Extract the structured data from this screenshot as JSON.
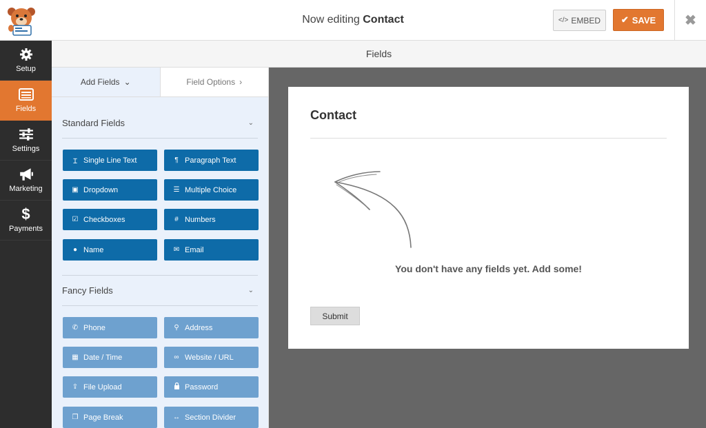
{
  "header": {
    "title_prefix": "Now editing",
    "title_name": "Contact",
    "embed_label": "EMBED",
    "save_label": "SAVE",
    "close_glyph": "✖"
  },
  "nav": {
    "items": [
      {
        "label": "Setup",
        "icon": "gear-icon"
      },
      {
        "label": "Fields",
        "icon": "fields-list-icon",
        "active": true
      },
      {
        "label": "Settings",
        "icon": "sliders-icon"
      },
      {
        "label": "Marketing",
        "icon": "megaphone-icon"
      },
      {
        "label": "Payments",
        "icon": "dollar-icon"
      }
    ]
  },
  "section_title": "Fields",
  "panel": {
    "tabs": [
      {
        "label": "Add Fields",
        "chevron": "⌄"
      },
      {
        "label": "Field Options",
        "chevron": "›"
      }
    ],
    "standard": {
      "title": "Standard Fields",
      "fields": [
        {
          "label": "Single Line Text",
          "icon": "text-cursor-icon",
          "glyph": "Ɪ"
        },
        {
          "label": "Paragraph Text",
          "icon": "pilcrow-icon",
          "glyph": "¶"
        },
        {
          "label": "Dropdown",
          "icon": "dropdown-icon",
          "glyph": "▣"
        },
        {
          "label": "Multiple Choice",
          "icon": "list-icon",
          "glyph": "☰"
        },
        {
          "label": "Checkboxes",
          "icon": "checkbox-icon",
          "glyph": "☑"
        },
        {
          "label": "Numbers",
          "icon": "hash-icon",
          "glyph": "#"
        },
        {
          "label": "Name",
          "icon": "user-icon",
          "glyph": "●"
        },
        {
          "label": "Email",
          "icon": "envelope-icon",
          "glyph": "✉"
        }
      ]
    },
    "fancy": {
      "title": "Fancy Fields",
      "fields": [
        {
          "label": "Phone",
          "icon": "phone-icon",
          "glyph": "✆"
        },
        {
          "label": "Address",
          "icon": "map-pin-icon",
          "glyph": "⚲"
        },
        {
          "label": "Date / Time",
          "icon": "calendar-icon",
          "glyph": "▦"
        },
        {
          "label": "Website / URL",
          "icon": "link-icon",
          "glyph": "∞"
        },
        {
          "label": "File Upload",
          "icon": "upload-icon",
          "glyph": "⇪"
        },
        {
          "label": "Password",
          "icon": "lock-icon",
          "glyph": "🔒"
        },
        {
          "label": "Page Break",
          "icon": "copy-icon",
          "glyph": "❐"
        },
        {
          "label": "Section Divider",
          "icon": "arrows-h-icon",
          "glyph": "↔"
        }
      ]
    }
  },
  "preview": {
    "form_title": "Contact",
    "empty_message": "You don't have any fields yet. Add some!",
    "submit_label": "Submit"
  },
  "colors": {
    "accent": "#e27730",
    "standard_button": "#0e6ba8",
    "fancy_button": "#6ea1cf",
    "nav_bg": "#2d2d2d"
  }
}
